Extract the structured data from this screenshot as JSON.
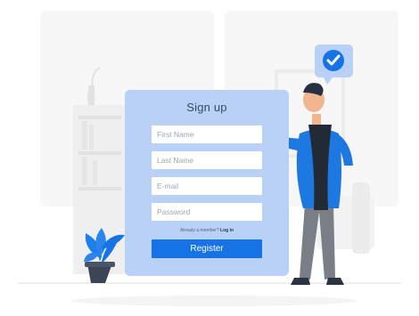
{
  "form": {
    "title": "Sign up",
    "fields": [
      {
        "placeholder": "First Name"
      },
      {
        "placeholder": "Last Name"
      },
      {
        "placeholder": "E-mail"
      },
      {
        "placeholder": "Password"
      }
    ],
    "already_member_text": "Already a member?",
    "login_link": "Log in",
    "register_label": "Register"
  },
  "icons": [
    "check-icon",
    "plant-icon",
    "vase-icon",
    "person-illustration"
  ],
  "colors": {
    "primary": "#1673e6",
    "card": "#b9d0f7",
    "bg": "#ffffff",
    "illustration_gray": "#f0f0f0"
  }
}
